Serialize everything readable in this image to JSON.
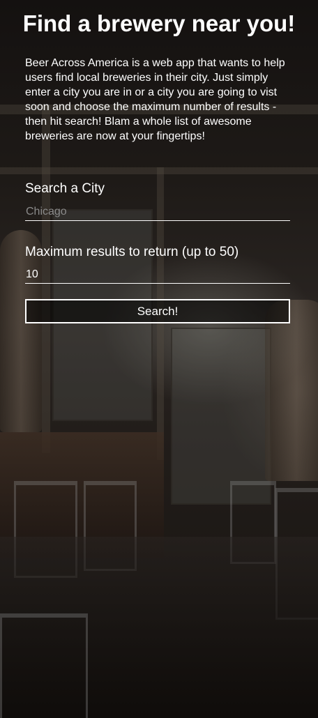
{
  "header": {
    "title": "Find a brewery near you!"
  },
  "intro": {
    "text": "Beer Across America is a web app that wants to help users find local breweries in their city. Just simply enter a city you are in or a city you are going to vist soon and choose the maximum number of results - then hit search! Blam a whole list of awesome breweries are now at your fingertips!"
  },
  "form": {
    "city_label": "Search a City",
    "city_placeholder": "Chicago",
    "city_value": "",
    "max_label": "Maximum results to return (up to 50)",
    "max_value": "10",
    "search_label": "Search!"
  },
  "colors": {
    "text": "#ffffff",
    "placeholder": "#8a8a8a",
    "border": "#ffffff"
  }
}
